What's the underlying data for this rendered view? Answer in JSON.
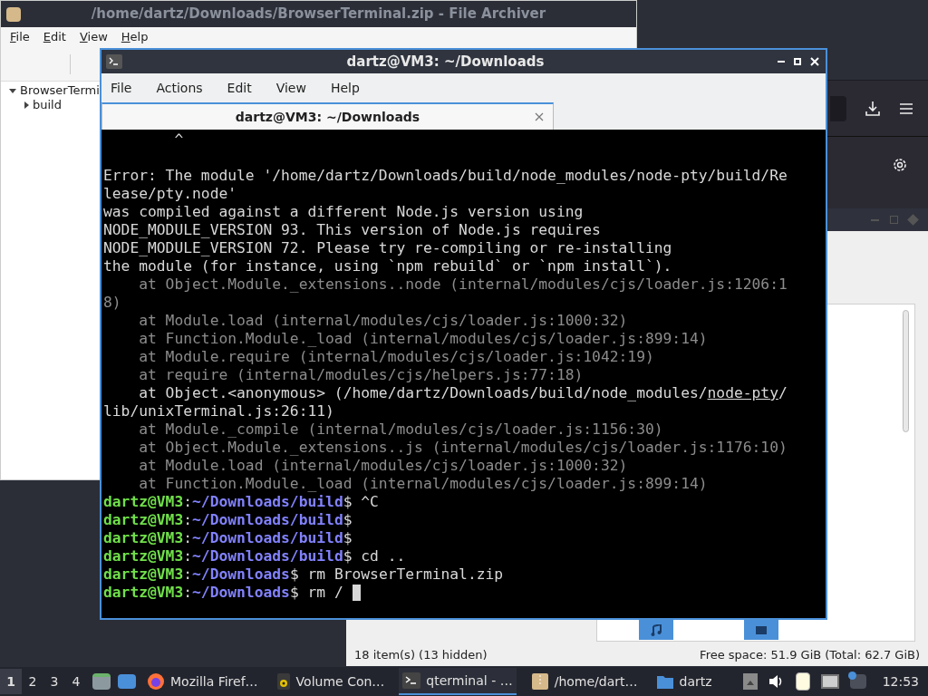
{
  "archiver": {
    "title": "/home/dartz/Downloads/BrowserTerminal.zip - File Archiver",
    "menu": [
      "File",
      "Edit",
      "View",
      "Help"
    ],
    "tree": [
      {
        "label": "BrowserTermi",
        "expanded": true,
        "children": [
          {
            "label": "build",
            "expanded": false
          }
        ]
      }
    ]
  },
  "file_manager": {
    "status_left": "18 item(s) (13 hidden)",
    "status_right": "Free space: 51.9 GiB (Total: 62.7 GiB)"
  },
  "terminal": {
    "title": "dartz@VM3: ~/Downloads",
    "menu": [
      "File",
      "Actions",
      "Edit",
      "View",
      "Help"
    ],
    "tabs": [
      {
        "label": "dartz@VM3: ~/Downloads",
        "selected": true
      }
    ],
    "lines": [
      {
        "kind": "text",
        "text": "        ^"
      },
      {
        "kind": "blank"
      },
      {
        "kind": "text",
        "text": "Error: The module '/home/dartz/Downloads/build/node_modules/node-pty/build/Re"
      },
      {
        "kind": "text",
        "text": "lease/pty.node'"
      },
      {
        "kind": "text",
        "text": "was compiled against a different Node.js version using"
      },
      {
        "kind": "text",
        "text": "NODE_MODULE_VERSION 93. This version of Node.js requires"
      },
      {
        "kind": "text",
        "text": "NODE_MODULE_VERSION 72. Please try re-compiling or re-installing"
      },
      {
        "kind": "text",
        "text": "the module (for instance, using `npm rebuild` or `npm install`)."
      },
      {
        "kind": "dim",
        "text": "    at Object.Module._extensions..node (internal/modules/cjs/loader.js:1206:1"
      },
      {
        "kind": "dim",
        "text": "8)"
      },
      {
        "kind": "dim",
        "text": "    at Module.load (internal/modules/cjs/loader.js:1000:32)"
      },
      {
        "kind": "dim",
        "text": "    at Function.Module._load (internal/modules/cjs/loader.js:899:14)"
      },
      {
        "kind": "dim",
        "text": "    at Module.require (internal/modules/cjs/loader.js:1042:19)"
      },
      {
        "kind": "dim",
        "text": "    at require (internal/modules/cjs/helpers.js:77:18)"
      },
      {
        "kind": "text",
        "text": "    at Object.<anonymous> (/home/dartz/Downloads/build/node_modules/",
        "link": "node-pty",
        "after": "/"
      },
      {
        "kind": "text",
        "text": "lib/unixTerminal.js:26:11)"
      },
      {
        "kind": "dim",
        "text": "    at Module._compile (internal/modules/cjs/loader.js:1156:30)"
      },
      {
        "kind": "dim",
        "text": "    at Object.Module._extensions..js (internal/modules/cjs/loader.js:1176:10)"
      },
      {
        "kind": "dim",
        "text": "    at Module.load (internal/modules/cjs/loader.js:1000:32)"
      },
      {
        "kind": "dim",
        "text": "    at Function.Module._load (internal/modules/cjs/loader.js:899:14)"
      },
      {
        "kind": "prompt",
        "user": "dartz@VM3",
        "sep": ":",
        "path": "~/Downloads/build",
        "symbol": "$",
        "command": "^C"
      },
      {
        "kind": "prompt",
        "user": "dartz@VM3",
        "sep": ":",
        "path": "~/Downloads/build",
        "symbol": "$"
      },
      {
        "kind": "prompt",
        "user": "dartz@VM3",
        "sep": ":",
        "path": "~/Downloads/build",
        "symbol": "$"
      },
      {
        "kind": "prompt",
        "user": "dartz@VM3",
        "sep": ":",
        "path": "~/Downloads/build",
        "symbol": "$",
        "command": "cd .."
      },
      {
        "kind": "prompt",
        "user": "dartz@VM3",
        "sep": ":",
        "path": "~/Downloads",
        "symbol": "$",
        "command": "rm BrowserTerminal.zip"
      },
      {
        "kind": "prompt",
        "user": "dartz@VM3",
        "sep": ":",
        "path": "~/Downloads",
        "symbol": "$",
        "command": "rm /",
        "cursor": true
      }
    ]
  },
  "taskbar": {
    "workspaces": [
      {
        "label": "1",
        "selected": true
      },
      {
        "label": "2",
        "selected": false
      },
      {
        "label": "3",
        "selected": false
      },
      {
        "label": "4",
        "selected": false
      }
    ],
    "tasks": [
      {
        "kind": "firefox",
        "label": "Mozilla Firef…",
        "selected": false
      },
      {
        "kind": "volume",
        "label": "Volume Con…",
        "selected": false
      },
      {
        "kind": "terminal",
        "label": "qterminal - …",
        "selected": true
      },
      {
        "kind": "archive",
        "label": "/home/dart…",
        "selected": false
      },
      {
        "kind": "folder",
        "label": "dartz",
        "selected": false
      }
    ],
    "clock": "12:53"
  }
}
